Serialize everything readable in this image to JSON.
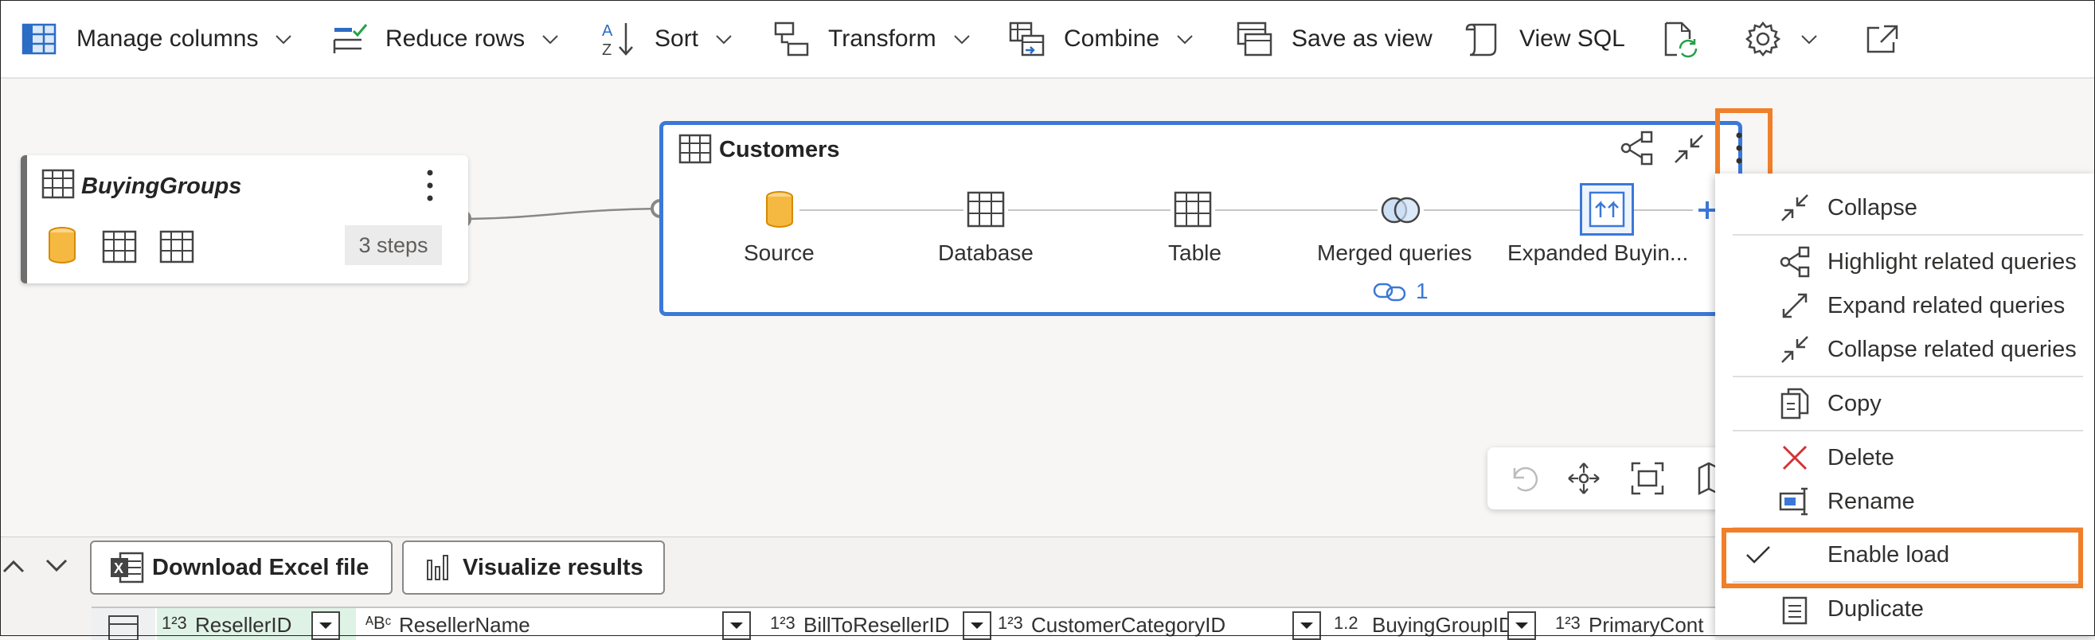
{
  "toolbar": {
    "items": [
      {
        "label": "Manage columns",
        "icon": "table-grid-icon",
        "chevron": true
      },
      {
        "label": "Reduce rows",
        "icon": "reduce-rows-icon",
        "chevron": true
      },
      {
        "label": "Sort",
        "icon": "sort-az-icon",
        "chevron": true
      },
      {
        "label": "Transform",
        "icon": "transform-icon",
        "chevron": true
      },
      {
        "label": "Combine",
        "icon": "combine-icon",
        "chevron": true
      },
      {
        "label": "Save as view",
        "icon": "save-view-icon",
        "chevron": false
      },
      {
        "label": "View SQL",
        "icon": "script-icon",
        "chevron": false
      }
    ],
    "extra_icons": [
      "refresh-doc-icon",
      "gear-icon",
      "popout-icon"
    ]
  },
  "buying_groups": {
    "title": "BuyingGroups",
    "steps": "3 steps"
  },
  "customers": {
    "title": "Customers",
    "steps": [
      {
        "label": "Source",
        "icon": "database-cylinder-icon"
      },
      {
        "label": "Database",
        "icon": "table-icon"
      },
      {
        "label": "Table",
        "icon": "table-icon"
      },
      {
        "label": "Merged queries",
        "icon": "merge-icon"
      },
      {
        "label": "Expanded Buyin...",
        "icon": "expand-column-icon"
      }
    ],
    "link_count": "1"
  },
  "context_menu": {
    "items": [
      {
        "label": "Collapse",
        "icon": "collapse-icon"
      },
      {
        "label": "Highlight related queries",
        "icon": "share-nodes-icon"
      },
      {
        "label": "Expand related queries",
        "icon": "expand-icon"
      },
      {
        "label": "Collapse related queries",
        "icon": "collapse-icon"
      },
      {
        "label": "Copy",
        "icon": "copy-icon"
      },
      {
        "label": "Delete",
        "icon": "delete-x-icon"
      },
      {
        "label": "Rename",
        "icon": "rename-icon"
      },
      {
        "label": "Enable load",
        "icon": "checkmark-icon",
        "checked": true
      },
      {
        "label": "Duplicate",
        "icon": "duplicate-icon"
      }
    ]
  },
  "bottom": {
    "download_label": "Download Excel file",
    "visualize_label": "Visualize results",
    "columns": [
      {
        "type": "1²3",
        "name": "ResellerID"
      },
      {
        "type": "ᴬBᶜ",
        "name": "ResellerName"
      },
      {
        "type": "1²3",
        "name": "BillToResellerID"
      },
      {
        "type": "1²3",
        "name": "CustomerCategoryID"
      },
      {
        "type": "1.2",
        "name": "BuyingGroupID"
      },
      {
        "type": "1²3",
        "name": "PrimaryCont"
      }
    ]
  },
  "colors": {
    "accent_blue": "#3b78d8",
    "highlight_orange": "#f07f2a",
    "delete_red": "#d13438"
  }
}
